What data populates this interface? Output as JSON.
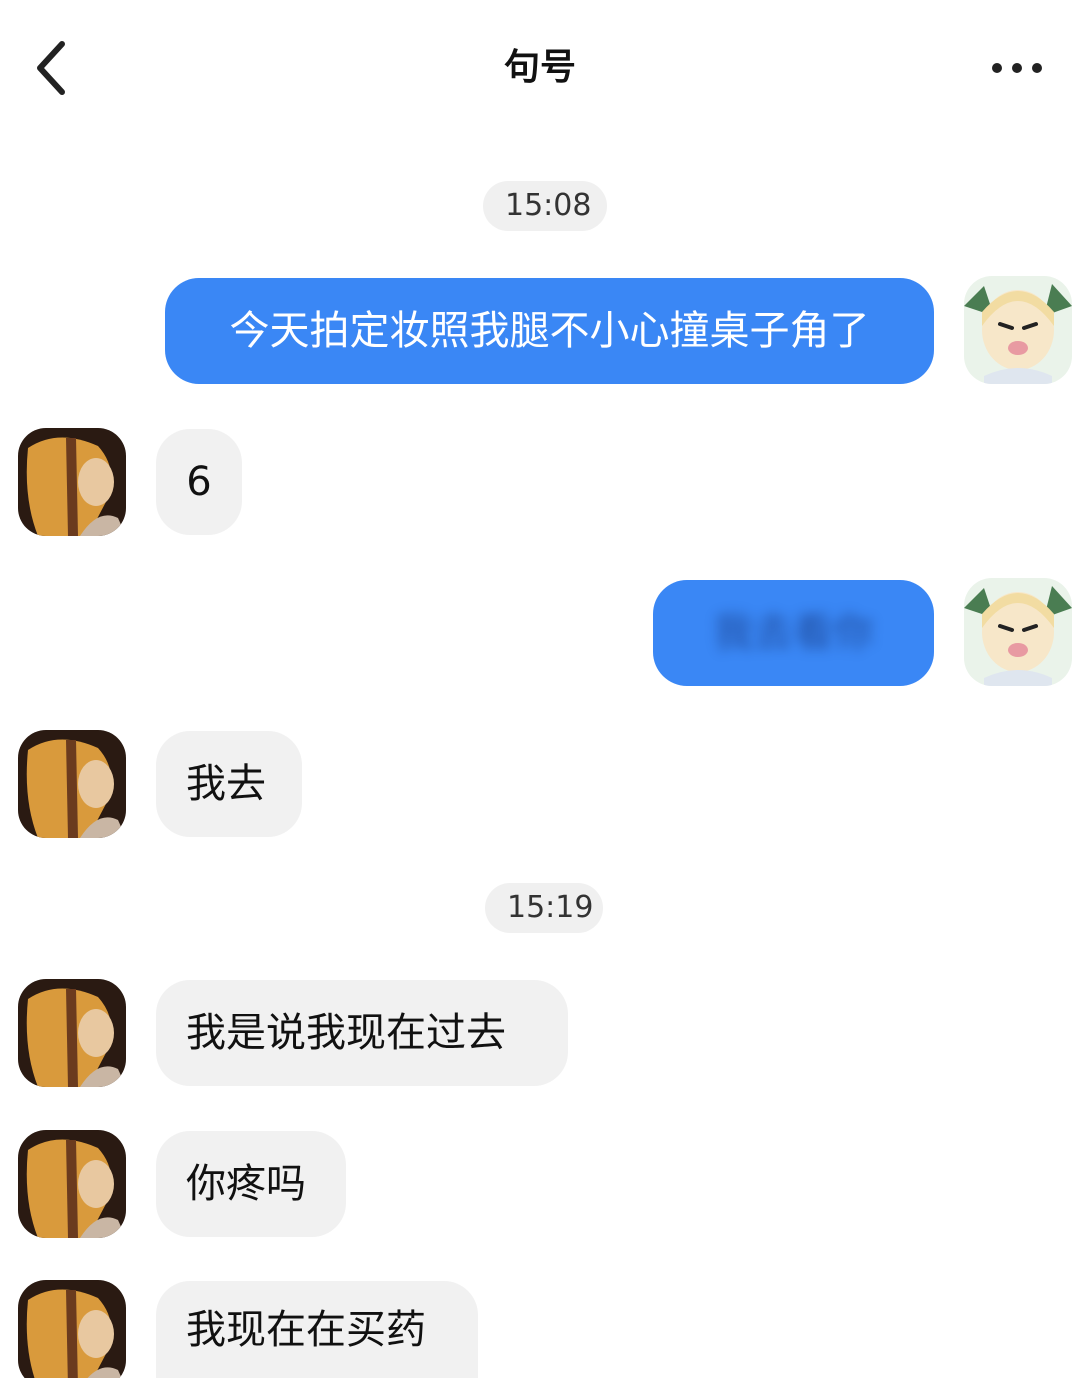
{
  "header": {
    "title": "句号",
    "back_icon": "chevron-left-icon",
    "more_icon": "more-horizontal-icon"
  },
  "colors": {
    "sent_bubble": "#3a87f5",
    "received_bubble": "#f1f1f1",
    "timestamp_pill": "#f0f0f0"
  },
  "timestamps": [
    "15:08",
    "15:19"
  ],
  "messages": [
    {
      "sender": "me",
      "text": "今天拍定妆照我腿不小心撞桌子角了"
    },
    {
      "sender": "them",
      "text": "6"
    },
    {
      "sender": "me",
      "text": "我去看你",
      "blurred": true
    },
    {
      "sender": "them",
      "text": "我去"
    },
    {
      "sender": "them",
      "text": "我是说我现在过去"
    },
    {
      "sender": "them",
      "text": "你疼吗"
    },
    {
      "sender": "them",
      "text": "我现在在买药"
    }
  ]
}
